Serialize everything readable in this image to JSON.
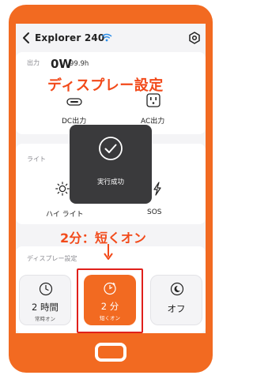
{
  "device": {
    "name": "Explorer 240"
  },
  "output": {
    "section_label": "出力",
    "watts": "0W",
    "hours": "99.9h",
    "dc_label": "DC出力",
    "ac_label": "AC出力"
  },
  "annotation": {
    "heading": "ディスプレー設定",
    "option_note": "2分：短くオン"
  },
  "light": {
    "section_label": "ライト",
    "high_label": "ハイ ライト",
    "sos_label": "SOS"
  },
  "toast": {
    "message": "実行成功"
  },
  "display_settings": {
    "section_label": "ディスプレー設定",
    "options": [
      {
        "main": "2 時間",
        "sub": "常時オン",
        "selected": false
      },
      {
        "main": "2 分",
        "sub": "短くオン",
        "selected": true
      },
      {
        "main": "オフ",
        "sub": "",
        "selected": false
      }
    ]
  },
  "colors": {
    "accent": "#F26A21",
    "annotation": "#F24A1A",
    "highlight_box": "#E0201B",
    "toast_bg": "#3A3A3C"
  },
  "icons": {
    "back": "chevron-left-icon",
    "wifi": "wifi-icon",
    "settings": "gear-icon",
    "dc": "dc-port-icon",
    "ac": "ac-outlet-icon",
    "light_high": "sun-icon",
    "light_sos": "flash-icon",
    "toast": "check-circle-icon",
    "clock": "clock-icon",
    "timer": "timer-icon",
    "off": "moon-icon"
  }
}
